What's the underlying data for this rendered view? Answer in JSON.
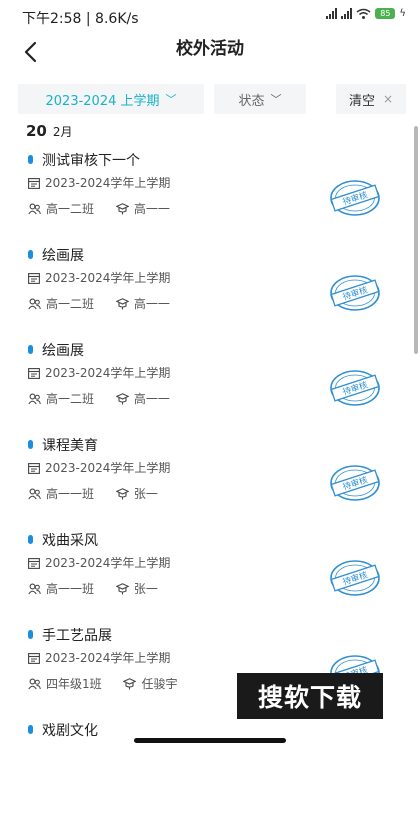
{
  "status_bar": {
    "time_speed": "下午2:58 | 8.6K/s",
    "battery": "85",
    "icons": [
      "signal-icon",
      "signal-icon",
      "wifi-icon",
      "battery-icon",
      "charging-icon"
    ]
  },
  "header": {
    "title": "校外活动",
    "back_icon": "back-arrow-icon"
  },
  "filters": {
    "term": "2023-2024 上学期",
    "status": "状态",
    "clear": "清空",
    "term_color": "#19b3c9"
  },
  "group": {
    "day": "20",
    "month": "2月"
  },
  "activities": [
    {
      "title": "测试审核下一个",
      "term": "2023-2024学年上学期",
      "class": "高一二班",
      "teacher": "高一一",
      "stamp": "待审核"
    },
    {
      "title": "绘画展",
      "term": "2023-2024学年上学期",
      "class": "高一二班",
      "teacher": "高一一",
      "stamp": "待审核"
    },
    {
      "title": "绘画展",
      "term": "2023-2024学年上学期",
      "class": "高一二班",
      "teacher": "高一一",
      "stamp": "待审核"
    },
    {
      "title": "课程美育",
      "term": "2023-2024学年上学期",
      "class": "高一一班",
      "teacher": "张一",
      "stamp": "待审核"
    },
    {
      "title": "戏曲采风",
      "term": "2023-2024学年上学期",
      "class": "高一一班",
      "teacher": "张一",
      "stamp": "待审核"
    },
    {
      "title": "手工艺品展",
      "term": "2023-2024学年上学期",
      "class": "四年级1班",
      "teacher": "任骏宇",
      "stamp": "待审核"
    },
    {
      "title": "戏剧文化"
    }
  ],
  "watermark": "搜软下载",
  "colors": {
    "accent": "#19b3c9",
    "title_dot": "#1a8fe0",
    "stamp": "#2f8fd1"
  }
}
